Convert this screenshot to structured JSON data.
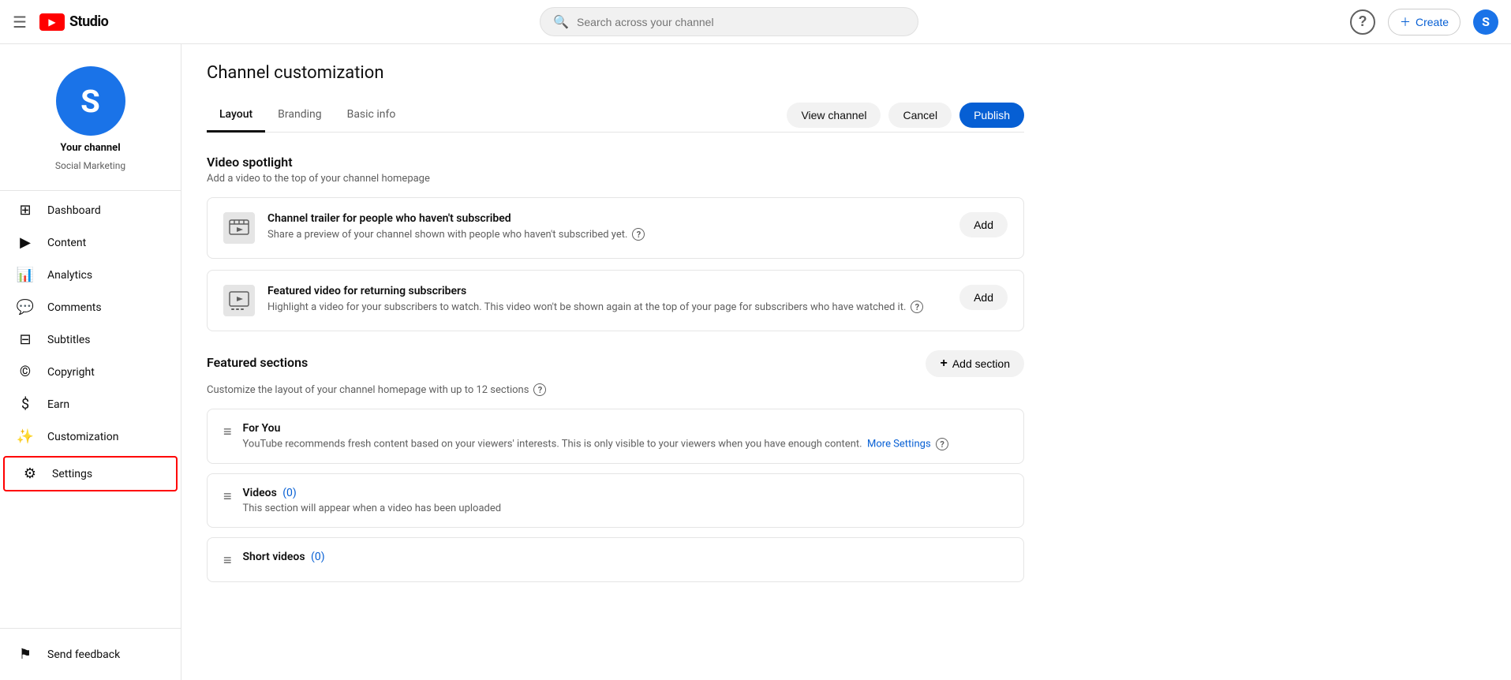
{
  "topnav": {
    "hamburger_label": "☰",
    "logo_text": "Studio",
    "search_placeholder": "Search across your channel",
    "help_label": "?",
    "create_label": "Create",
    "avatar_letter": "S"
  },
  "sidebar": {
    "channel_name": "Your channel",
    "channel_sub": "Social Marketing",
    "channel_avatar_letter": "S",
    "items": [
      {
        "id": "dashboard",
        "label": "Dashboard",
        "icon": "⊞"
      },
      {
        "id": "content",
        "label": "Content",
        "icon": "▶"
      },
      {
        "id": "analytics",
        "label": "Analytics",
        "icon": "📊"
      },
      {
        "id": "comments",
        "label": "Comments",
        "icon": "💬"
      },
      {
        "id": "subtitles",
        "label": "Subtitles",
        "icon": "⊟"
      },
      {
        "id": "copyright",
        "label": "Copyright",
        "icon": "©"
      },
      {
        "id": "earn",
        "label": "Earn",
        "icon": "$"
      },
      {
        "id": "customization",
        "label": "Customization",
        "icon": "✨"
      },
      {
        "id": "settings",
        "label": "Settings",
        "icon": "⚙",
        "highlighted": true
      }
    ],
    "send_feedback_label": "Send feedback",
    "send_feedback_icon": "⚑"
  },
  "main": {
    "page_title": "Channel customization",
    "tabs": [
      {
        "id": "layout",
        "label": "Layout",
        "active": true
      },
      {
        "id": "branding",
        "label": "Branding",
        "active": false
      },
      {
        "id": "basic_info",
        "label": "Basic info",
        "active": false
      }
    ],
    "actions": {
      "view_channel": "View channel",
      "cancel": "Cancel",
      "publish": "Publish"
    },
    "video_spotlight": {
      "title": "Video spotlight",
      "subtitle": "Add a video to the top of your channel homepage",
      "channel_trailer": {
        "title": "Channel trailer for people who haven't subscribed",
        "desc": "Share a preview of your channel shown with people who haven't subscribed yet.",
        "add_label": "Add"
      },
      "featured_video": {
        "title": "Featured video for returning subscribers",
        "desc": "Highlight a video for your subscribers to watch. This video won't be shown again at the top of your page for subscribers who have watched it.",
        "add_label": "Add"
      }
    },
    "featured_sections": {
      "title": "Featured sections",
      "subtitle": "Customize the layout of your channel homepage with up to 12 sections",
      "add_section_label": "Add section",
      "items": [
        {
          "id": "for_you",
          "title": "For You",
          "count": null,
          "desc": "YouTube recommends fresh content based on your viewers' interests. This is only visible to your viewers when you have enough content.",
          "more_settings": "More Settings"
        },
        {
          "id": "videos",
          "title": "Videos",
          "count": "(0)",
          "desc": "This section will appear when a video has been uploaded"
        },
        {
          "id": "short_videos",
          "title": "Short videos",
          "count": "(0)",
          "desc": ""
        }
      ]
    }
  }
}
